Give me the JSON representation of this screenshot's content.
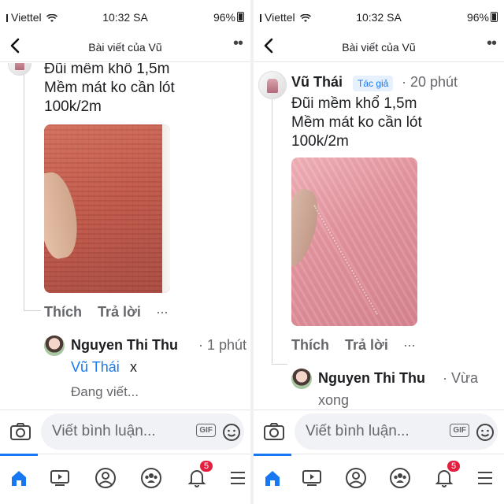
{
  "status_bar": {
    "carrier": "Viettel",
    "time": "10:32 SA",
    "battery": "96%"
  },
  "header": {
    "title": "Bài viết của Vũ"
  },
  "left": {
    "post": {
      "body": [
        "Đũi mềm khổ 1,5m",
        "Mềm mát ko cần lót",
        "100k/2m"
      ],
      "actions": {
        "like": "Thích",
        "reply": "Trả lời",
        "more": "···"
      }
    },
    "reply": {
      "author": "Nguyen Thi Thu",
      "time": "· 1 phút",
      "mention": "Vũ Thái",
      "text": "x"
    },
    "typing": "Đang viết..."
  },
  "right": {
    "post": {
      "author": "Vũ Thái",
      "badge": "Tác giả",
      "time": "· 20 phút",
      "body": [
        "Đũi mềm khổ 1,5m",
        "Mềm mát ko cần lót",
        "100k/2m"
      ],
      "actions": {
        "like": "Thích",
        "reply": "Trả lời",
        "more": "···"
      }
    },
    "reply": {
      "author": "Nguyen Thi Thu",
      "time": "· Vừa",
      "time_cont": "xong"
    }
  },
  "composer": {
    "placeholder": "Viết bình luận...",
    "gif_label": "GIF"
  },
  "tabbar": {
    "notification_count": "5"
  },
  "colors": {
    "accent": "#1877f2",
    "badge_red": "#e41e3f",
    "secondary_text": "#65676b"
  }
}
